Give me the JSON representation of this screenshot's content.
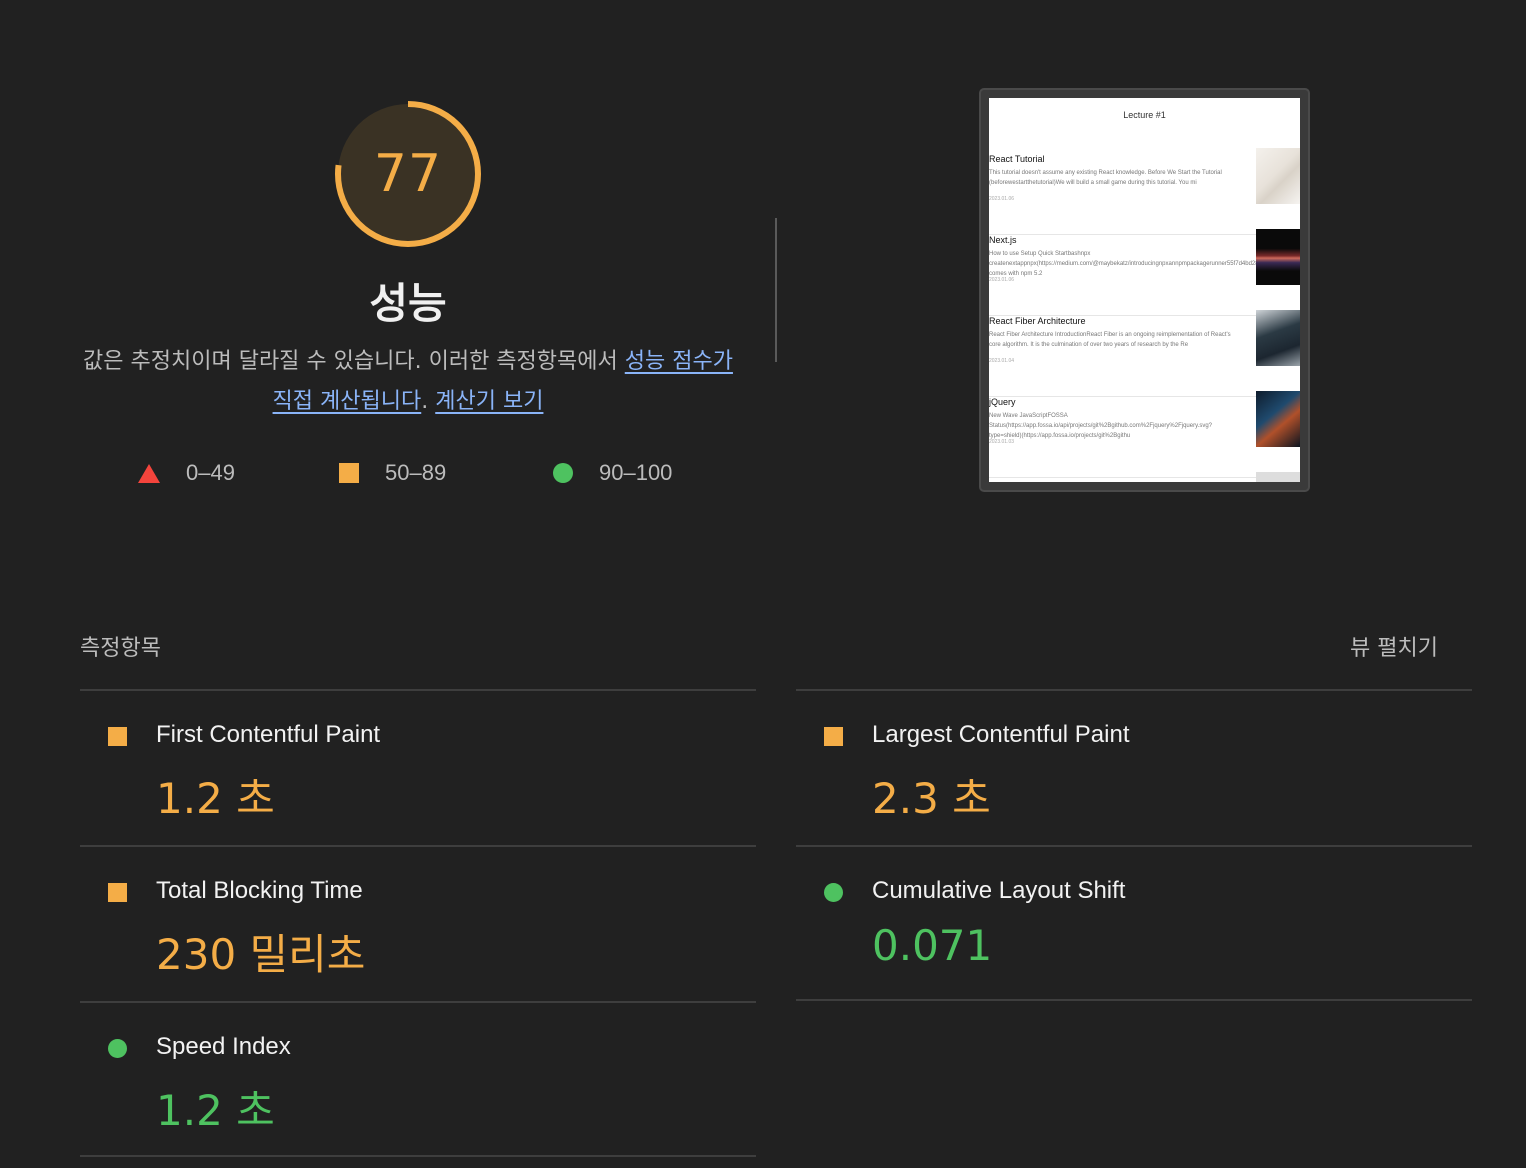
{
  "colors": {
    "background": "#212121",
    "average": "#f4ad47",
    "pass": "#4ec260",
    "fail": "#f4443c",
    "link": "#8ab4f8"
  },
  "gauge": {
    "score": "77",
    "score_fraction": 0.77,
    "title": "성능"
  },
  "description": {
    "text": "값은 추정치이며 달라질 수 있습니다. 이러한 측정항목에서 ",
    "link1": "성능 점수가 직접 계산됩니다",
    "sep": ". ",
    "link2": "계산기 보기"
  },
  "legend": [
    {
      "shape": "triangle",
      "label": "0–49"
    },
    {
      "shape": "square",
      "label": "50–89"
    },
    {
      "shape": "circle",
      "label": "90–100"
    }
  ],
  "screenshot": {
    "title": "Lecture #1",
    "posts": [
      {
        "title": "React Tutorial",
        "body": "This tutorial doesn't assume any existing React knowledge. Before We Start the Tutorial (beforewestartthetutorial)We will build a small game during this tutorial. You mi",
        "date": "2023.01.06"
      },
      {
        "title": "Next.js",
        "body": "How to use Setup Quick Startbashnpx createnextappnpx(https://medium.com/@maybekatz/introducingnpxannpmpackagerunner55f7d4bd282b) comes with npm 5.2",
        "date": "2023.01.06"
      },
      {
        "title": "React Fiber Architecture",
        "body": "React Fiber Architecture IntroductionReact Fiber is an ongoing reimplementation of React's core algorithm. It is the culmination of over two years of research by the Re",
        "date": "2023.01.04"
      },
      {
        "title": "jQuery",
        "body": "New Wave JavaScriptFOSSA Status(https://app.fossa.io/api/projects/git%2Bgithub.com%2Fjquery%2Fjquery.svg?type=shield)(https://app.fossa.io/projects/git%2Bgithu",
        "date": "2023.01.03"
      }
    ]
  },
  "metrics_section": {
    "label": "측정항목",
    "expand": "뷰 펼치기"
  },
  "metrics": [
    {
      "name": "First Contentful Paint",
      "value": "1.2 초",
      "rating": "average"
    },
    {
      "name": "Largest Contentful Paint",
      "value": "2.3 초",
      "rating": "average"
    },
    {
      "name": "Total Blocking Time",
      "value": "230 밀리초",
      "rating": "average"
    },
    {
      "name": "Cumulative Layout Shift",
      "value": "0.071",
      "rating": "pass"
    },
    {
      "name": "Speed Index",
      "value": "1.2 초",
      "rating": "pass"
    }
  ]
}
